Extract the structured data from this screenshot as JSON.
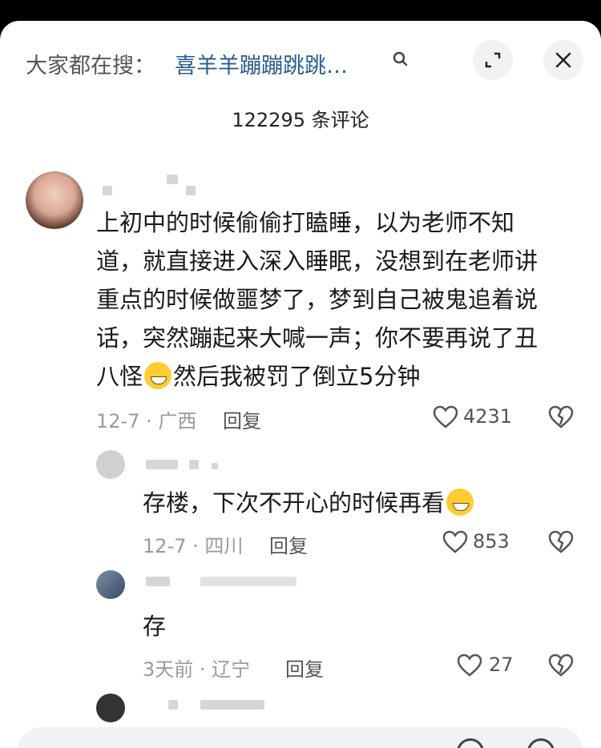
{
  "header": {
    "hot_prefix": "大家都在搜：",
    "hot_query": "喜羊羊蹦蹦跳跳…",
    "comment_count": "122295 条评论"
  },
  "comments": [
    {
      "text_lines": [
        "上初中的时候偷偷打瞌睡，以为老师不知",
        "道，就直接进入深入睡眠，没想到在老师讲",
        "重点的时候做噩梦了，梦到自己被鬼追着说",
        "话，突然蹦起来大喊一声；你不要再说了丑"
      ],
      "last_line_a": "八怪",
      "last_line_b": "然后我被罚了倒立5分钟",
      "meta": "12-7 · 广西",
      "reply_label": "回复",
      "likes": "4231"
    },
    {
      "text": "存楼，下次不开心的时候再看",
      "meta": "12-7 · 四川",
      "reply_label": "回复",
      "likes": "853"
    },
    {
      "text": "存",
      "meta": "3天前 · 辽宁",
      "reply_label": "回复",
      "likes": "27"
    }
  ],
  "icons": {
    "search": "search-icon",
    "expand": "expand-icon",
    "close": "close-icon",
    "like": "heart-icon",
    "dislike": "broken-heart-icon"
  },
  "colors": {
    "query_link": "#2a5d8f",
    "meta": "#9a9a9a"
  }
}
